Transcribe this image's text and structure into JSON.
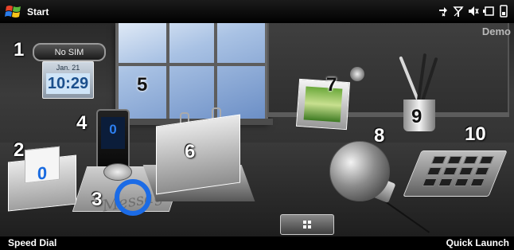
{
  "topbar": {
    "start_label": "Start",
    "status_icons": [
      "data-connection-icon",
      "signal-off-icon",
      "volume-off-icon",
      "battery-icon",
      "storage-icon"
    ]
  },
  "room": {
    "demo_label": "Demo",
    "widgets": [
      {
        "number": "1",
        "name": "clock",
        "sim_status": "No SIM",
        "date": "Jan. 21",
        "time": "10:29"
      },
      {
        "number": "2",
        "name": "email",
        "count": "0"
      },
      {
        "number": "3",
        "name": "message",
        "count": "0",
        "pad_text": "Message"
      },
      {
        "number": "4",
        "name": "phone",
        "count": "0"
      },
      {
        "number": "5",
        "name": "window"
      },
      {
        "number": "6",
        "name": "calendar"
      },
      {
        "number": "7",
        "name": "photo-frame"
      },
      {
        "number": "8",
        "name": "globe"
      },
      {
        "number": "9",
        "name": "pen-cup"
      },
      {
        "number": "10",
        "name": "keypad"
      }
    ]
  },
  "softkeys": {
    "left": "Speed Dial",
    "right": "Quick Launch"
  },
  "colors": {
    "accent_blue": "#1b6be6",
    "clock_text": "#1b4f8c",
    "background": "#000000"
  }
}
